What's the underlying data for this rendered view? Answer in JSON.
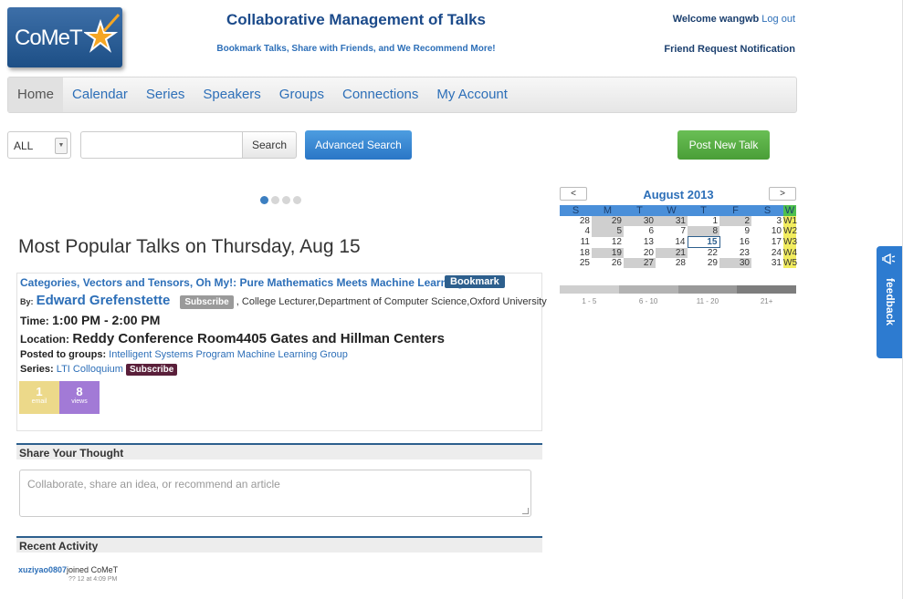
{
  "header": {
    "logo_text": "CoMeT",
    "title": "Collaborative Management of Talks",
    "tagline": "Bookmark Talks, Share with Friends, and We Recommend More!",
    "welcome": "Welcome wangwb",
    "logout": "Log out",
    "friend_request": "Friend Request Notification"
  },
  "nav": {
    "items": [
      "Home",
      "Calendar",
      "Series",
      "Speakers",
      "Groups",
      "Connections",
      "My Account"
    ]
  },
  "search": {
    "scope": "ALL",
    "button": "Search",
    "advanced": "Advanced Search",
    "post_new": "Post New Talk"
  },
  "popular": {
    "heading": "Most Popular Talks on Thursday, Aug 15",
    "talk": {
      "title": "Categories, Vectors and Tensors, Oh My!: Pure Mathematics Meets Machine Learning",
      "bookmark": "Bookmark",
      "by_label": "By:",
      "speaker": "Edward Grefenstette",
      "subscribe": "Subscribe",
      "affiliation": ", College Lecturer,Department of Computer Science,Oxford University",
      "time_label": "Time:",
      "time": "1:00 PM - 2:00 PM",
      "location_label": "Location:",
      "location": "Reddy Conference Room4405 Gates and Hillman Centers",
      "groups_label": "Posted to groups:",
      "groups": "Intelligent Systems Program Machine Learning Group",
      "series_label": "Series:",
      "series": "LTI Colloquium",
      "series_subscribe": "Subscribe",
      "email_count": "1",
      "email_label": "email",
      "views_count": "8",
      "views_label": "views"
    }
  },
  "share": {
    "heading": "Share Your Thought",
    "placeholder": "Collaborate, share an idea, or recommend an article"
  },
  "activity": {
    "heading": "Recent Activity",
    "user": "xuziyao0807",
    "action": "joined CoMeT",
    "time": "?? 12 at 4:09 PM"
  },
  "calendar": {
    "prev": "<",
    "next": ">",
    "month": "August 2013",
    "days": [
      "S",
      "M",
      "T",
      "W",
      "T",
      "F",
      "S",
      "W"
    ],
    "weeks": [
      [
        "28",
        "29",
        "30",
        "31",
        "1",
        "2",
        "3",
        "W1"
      ],
      [
        "4",
        "5",
        "6",
        "7",
        "8",
        "9",
        "10",
        "W2"
      ],
      [
        "11",
        "12",
        "13",
        "14",
        "15",
        "16",
        "17",
        "W3"
      ],
      [
        "18",
        "19",
        "20",
        "21",
        "22",
        "23",
        "24",
        "W4"
      ],
      [
        "25",
        "26",
        "27",
        "28",
        "29",
        "30",
        "31",
        "W5"
      ]
    ],
    "legend": [
      "1 - 5",
      "6 - 10",
      "11 - 20",
      "21+"
    ],
    "legend_colors": [
      "#cfcfcf",
      "#b3b3b3",
      "#999999",
      "#7d7d7d"
    ]
  },
  "feedback": {
    "label": "feedback"
  }
}
